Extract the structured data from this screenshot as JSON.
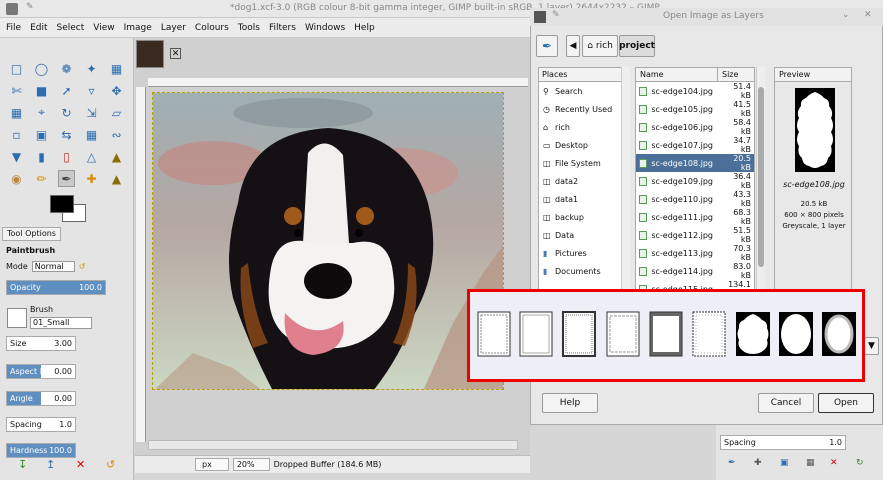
{
  "window": {
    "title": "*dog1.xcf-3.0 (RGB colour 8-bit gamma integer, GIMP built-in sRGB, 1 layer) 2644x2232 – GIMP"
  },
  "menubar": [
    "File",
    "Edit",
    "Select",
    "View",
    "Image",
    "Layer",
    "Colours",
    "Tools",
    "Filters",
    "Windows",
    "Help"
  ],
  "toolbox": {
    "tab_label": "Tool Options",
    "tool_name": "Paintbrush",
    "mode_label": "Mode",
    "mode_value": "Normal",
    "opacity": {
      "label": "Opacity",
      "value": "100.0",
      "fraction": 1.0
    },
    "brush_label": "Brush",
    "brush_value": "01_Small",
    "size": {
      "label": "Size",
      "value": "3.00"
    },
    "aspect": {
      "label": "Aspect Ra...",
      "value": "0.00"
    },
    "angle": {
      "label": "Angle",
      "value": "0.00"
    },
    "spacing": {
      "label": "Spacing",
      "value": "1.0"
    },
    "hardness": {
      "label": "Hardness",
      "value": "100.0"
    }
  },
  "statusbar": {
    "unit": "px",
    "zoom": "20%",
    "message": "Dropped Buffer (184.6 MB)"
  },
  "dialog": {
    "title": "Open Image as Layers",
    "path": [
      "rich",
      "project"
    ],
    "places_header": "Places",
    "places": [
      "Search",
      "Recently Used",
      "rich",
      "Desktop",
      "File System",
      "data2",
      "data1",
      "backup",
      "Data",
      "Pictures",
      "Documents"
    ],
    "files_header": {
      "name": "Name",
      "size": "Size"
    },
    "files": [
      {
        "name": "sc-edge104.jpg",
        "size": "51.4 kB"
      },
      {
        "name": "sc-edge105.jpg",
        "size": "41.5 kB"
      },
      {
        "name": "sc-edge106.jpg",
        "size": "58.4 kB"
      },
      {
        "name": "sc-edge107.jpg",
        "size": "34.7 kB"
      },
      {
        "name": "sc-edge108.jpg",
        "size": "20.5 kB"
      },
      {
        "name": "sc-edge109.jpg",
        "size": "36.4 kB"
      },
      {
        "name": "sc-edge110.jpg",
        "size": "43.3 kB"
      },
      {
        "name": "sc-edge111.jpg",
        "size": "68.3 kB"
      },
      {
        "name": "sc-edge112.jpg",
        "size": "51.5 kB"
      },
      {
        "name": "sc-edge113.jpg",
        "size": "70.3 kB"
      },
      {
        "name": "sc-edge114.jpg",
        "size": "83.0 kB"
      },
      {
        "name": "sc-edge115.jpg",
        "size": "134.1 kB"
      }
    ],
    "selected_index": 4,
    "preview_header": "Preview",
    "preview_filename": "sc-edge108.jpg",
    "preview_info": [
      "20.5 kB",
      "600 × 800 pixels",
      "Greyscale, 1 layer"
    ],
    "help_button": "Help",
    "cancel_button": "Cancel",
    "open_button": "Open"
  },
  "right_panel": {
    "spacing_label": "Spacing",
    "spacing_value": "1.0"
  }
}
